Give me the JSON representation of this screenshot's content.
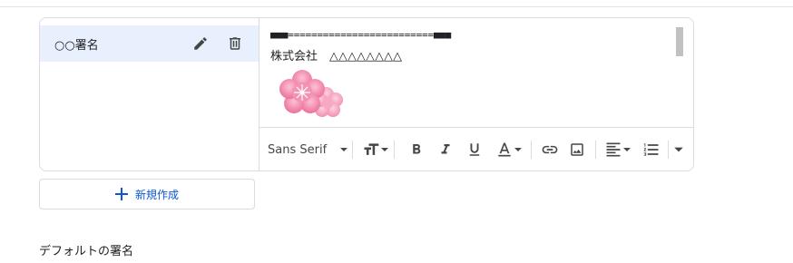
{
  "signatures": {
    "items": [
      {
        "name": "○○署名"
      }
    ]
  },
  "editor": {
    "line1": "■■■=========================■■■",
    "line2": "株式会社　△△△△△△△△",
    "image_icon": "pink-plum-blossom-image"
  },
  "toolbar": {
    "font": "Sans Serif",
    "icons": [
      "font-size-icon",
      "bold-icon",
      "italic-icon",
      "underline-icon",
      "text-color-icon",
      "link-icon",
      "image-icon",
      "align-icon",
      "numbered-list-icon",
      "more-icon"
    ]
  },
  "actions": {
    "new_label": "新規作成"
  },
  "section": {
    "default_signature_label": "デフォルトの署名"
  },
  "colors": {
    "selected_bg": "#e8f0fe",
    "accent": "#0b57d0",
    "blossom": "#f48fb1"
  }
}
